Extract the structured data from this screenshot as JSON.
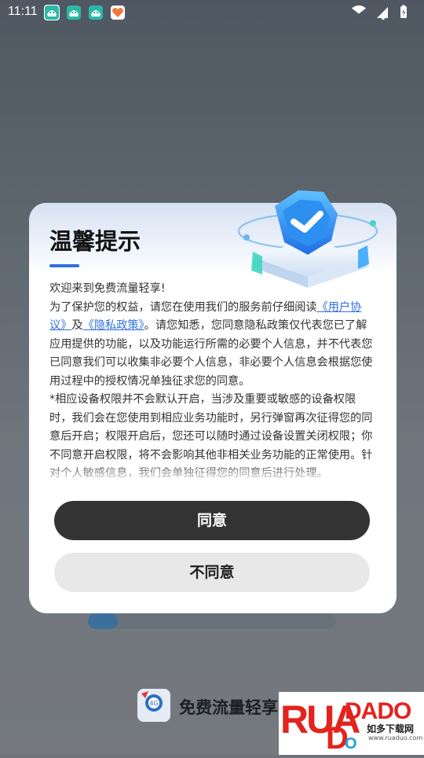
{
  "status_bar": {
    "time": "11:11",
    "notification_icons": [
      "game-controller-icon",
      "game-controller-icon",
      "game-controller-icon",
      "heart-app-icon"
    ]
  },
  "dialog": {
    "title": "温馨提示",
    "intro": "欢迎来到免费流量轻享!",
    "p1_before": "为了保护您的权益，请您在使用我们的服务前仔细阅读",
    "user_agreement_link": "《用户协议》",
    "p1_and": "及",
    "privacy_link": "《隐私政策》",
    "p1_after": "。请您知悉，您同意隐私政策仅代表您已了解应用提供的功能，以及功能运行所需的必要个人信息，并不代表您已同意我们可以收集非必要个人信息，非必要个人信息会根据您使用过程中的授权情况单独征求您的同意。",
    "p2": "*相应设备权限并不会默认开启，当涉及重要或敏感的设备权限时，我们会在您使用到相应业务功能时，另行弹窗再次征得您的同意后开启；权限开启后，您还可以随时通过设备设置关闭权限；你不同意开启权限，将不会影响其他非相关业务功能的正常使用。针对个人敏感信息，我们会单独征得您的同意后进行处理。",
    "agree_button": "同意",
    "disagree_button": "不同意"
  },
  "background_app": {
    "app_name": "免费流量轻享",
    "app_icon_caption": "免费流量轻享",
    "progress": 0.12
  },
  "watermark": {
    "brand": "RUANDADO",
    "sub": "如多下载网",
    "url": "www.ruaduo.com"
  },
  "colors": {
    "accent": "#2f6fe0",
    "agree_bg": "#333333",
    "disagree_bg": "#e8e8e8"
  }
}
